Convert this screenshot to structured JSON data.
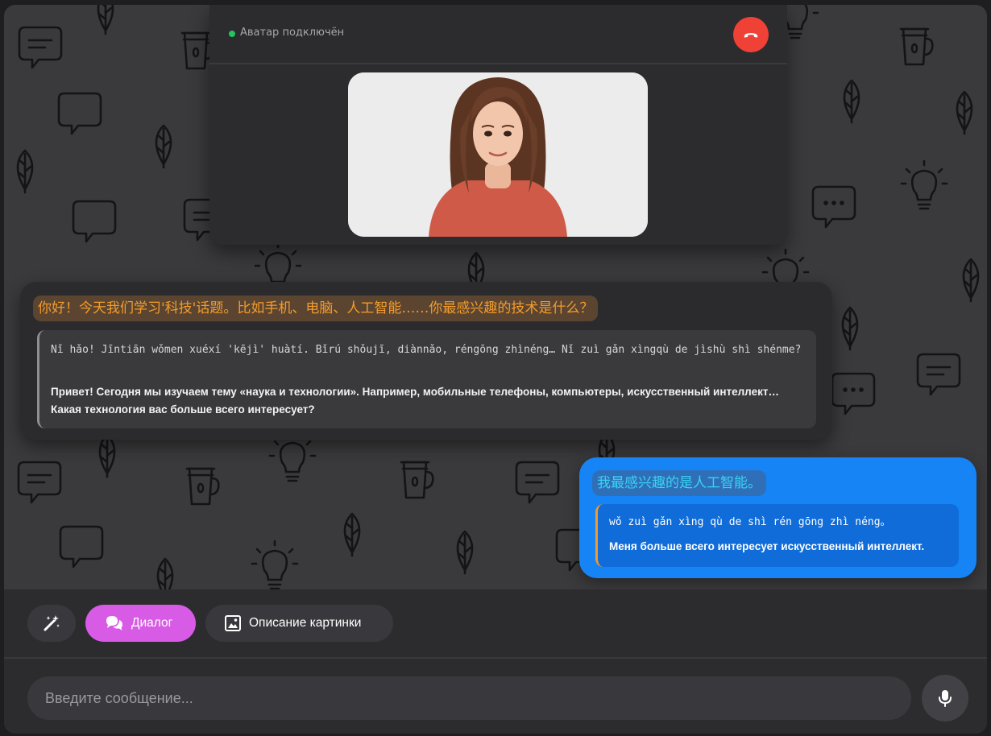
{
  "avatar": {
    "status_text": "Аватар подключён",
    "status_color": "#22c55e",
    "hangup_icon": "phone-hangup-icon"
  },
  "messages": {
    "bot": {
      "hanzi": "你好！今天我们学习'科技'话题。比如手机、电脑、人工智能……你最感兴趣的技术是什么？",
      "pinyin": "Nǐ hǎo! Jīntiān wǒmen xuéxí 'kējì' huàtí. Bǐrú shǒujī, diànnǎo, réngōng zhìnéng… Nǐ zuì gǎn xìngqù de jìshù shì shénme?",
      "translation": "Привет! Сегодня мы изучаем тему «наука и технологии». Например, мобильные телефоны, компьютеры, искусственный интеллект… Какая технология вас больше всего интересует?"
    },
    "user": {
      "hanzi": "我最感兴趣的是人工智能。",
      "pinyin": "wǒ zuì gǎn xìng qù de shì rén gōng zhì néng。",
      "translation": "Меня больше всего интересует искусственный интеллект."
    }
  },
  "toolbar": {
    "magic_icon": "magic-wand-icon",
    "dialog_label": "Диалог",
    "dialog_icon": "chat-bubbles-icon",
    "picture_label": "Описание картинки",
    "picture_icon": "image-icon"
  },
  "composer": {
    "placeholder": "Введите сообщение...",
    "mic_icon": "microphone-icon"
  },
  "colors": {
    "background": "#3a3a3c",
    "bot_hanzi": "#f39c2c",
    "user_bubble": "#1684f5",
    "user_hanzi": "#38d4f2",
    "dialog_button": "#d85be6",
    "hangup": "#ef4136"
  }
}
